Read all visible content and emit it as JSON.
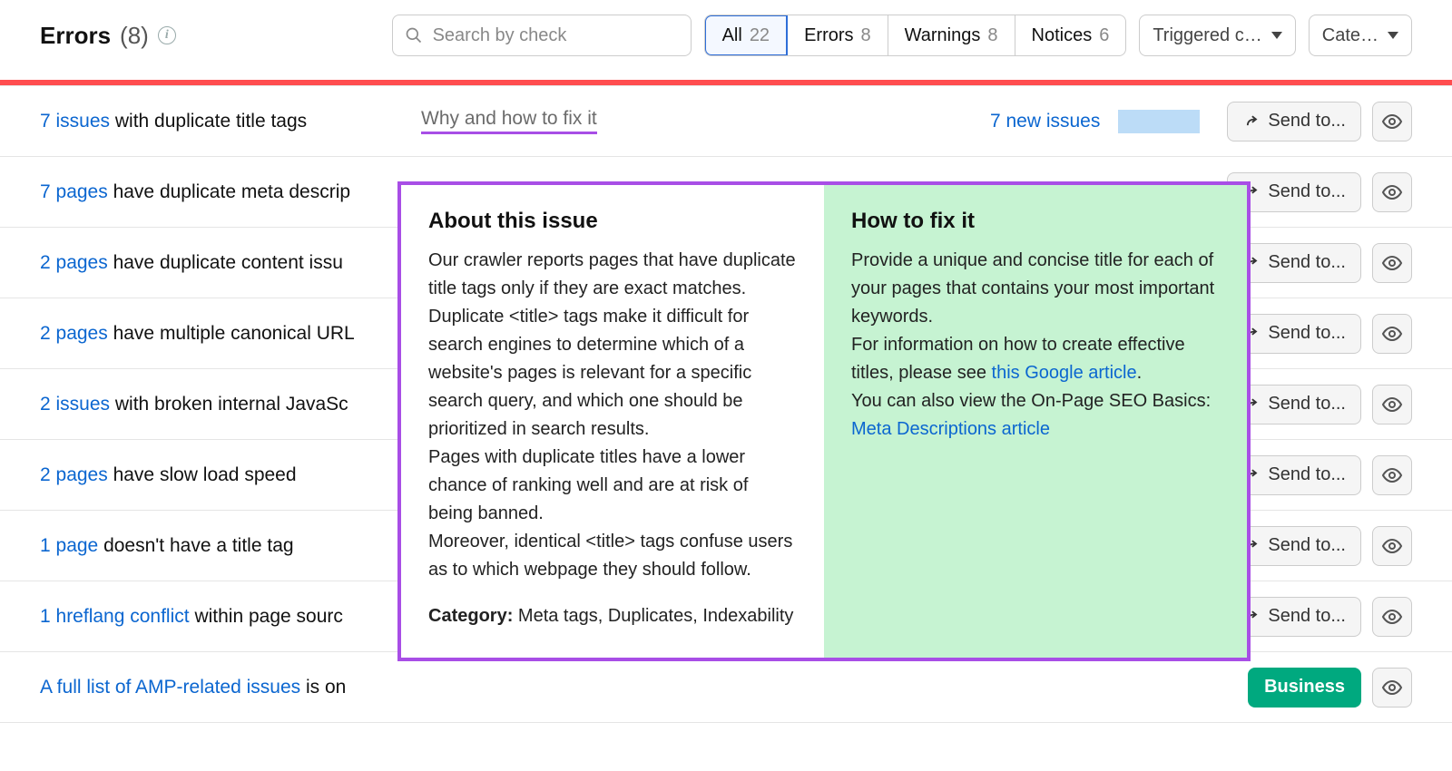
{
  "header": {
    "title": "Errors",
    "count": "(8)"
  },
  "search": {
    "placeholder": "Search by check"
  },
  "tabs": [
    {
      "label": "All",
      "count": "22"
    },
    {
      "label": "Errors",
      "count": "8"
    },
    {
      "label": "Warnings",
      "count": "8"
    },
    {
      "label": "Notices",
      "count": "6"
    }
  ],
  "filters": {
    "triggered": "Triggered c…",
    "category": "Cate…"
  },
  "why_label": "Why and how to fix it",
  "sendto_label": "Send to...",
  "rows": [
    {
      "link": "7 issues",
      "rest": " with duplicate title tags",
      "new": "7 new issues"
    },
    {
      "link": "7 pages",
      "rest": " have duplicate meta descrip"
    },
    {
      "link": "2 pages",
      "rest": " have duplicate content issu"
    },
    {
      "link": "2 pages",
      "rest": " have multiple canonical URL"
    },
    {
      "link": "2 issues",
      "rest": " with broken internal JavaSc"
    },
    {
      "link": "2 pages",
      "rest": " have slow load speed"
    },
    {
      "link": "1 page",
      "rest": " doesn't have a title tag"
    },
    {
      "link": "1 hreflang conflict",
      "rest": " within page sourc"
    },
    {
      "link": "A full list of AMP-related issues",
      "rest": " is on"
    }
  ],
  "business_label": "Business",
  "popover": {
    "about_title": "About this issue",
    "about_p1": "Our crawler reports pages that have duplicate title tags only if they are exact matches.",
    "about_p2": "Duplicate <title> tags make it difficult for search engines to determine which of a website's pages is relevant for a specific search query, and which one should be prioritized in search results.",
    "about_p3": "Pages with duplicate titles have a lower chance of ranking well and are at risk of being banned.",
    "about_p4": "Moreover, identical <title> tags confuse users as to which webpage they should follow.",
    "category_label": "Category:",
    "category_value": " Meta tags, Duplicates, Indexability",
    "fix_title": "How to fix it",
    "fix_p1": "Provide a unique and concise title for each of your pages that contains your most important keywords.",
    "fix_p2a": "For information on how to create effective titles, please see ",
    "fix_link1": "this Google article",
    "fix_p2b": ".",
    "fix_p3a": "You can also view the On-Page SEO Basics: ",
    "fix_link2": "Meta Descriptions article"
  }
}
